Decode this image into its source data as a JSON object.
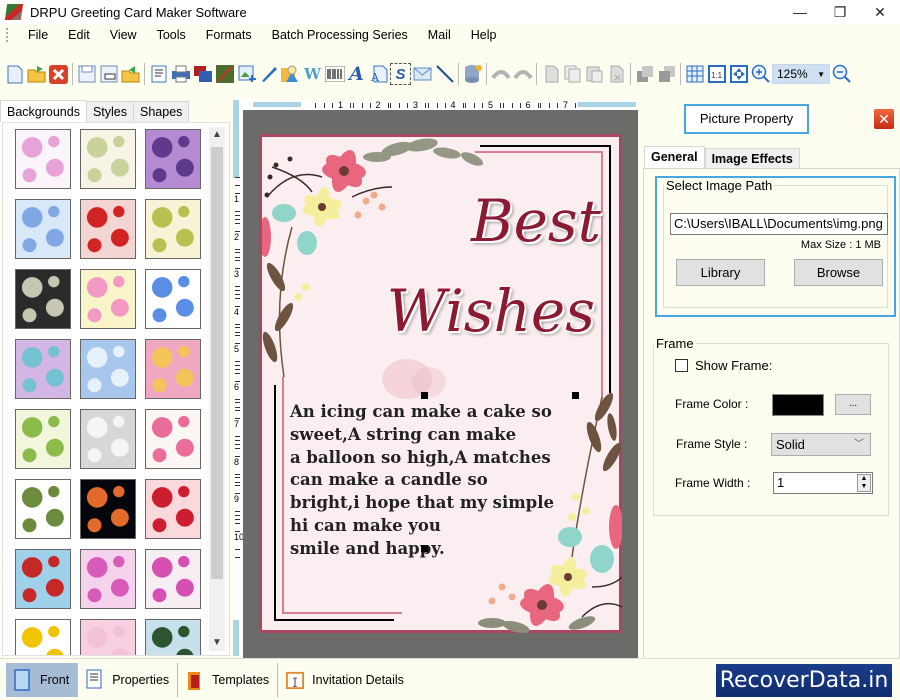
{
  "window": {
    "title": "DRPU Greeting Card Maker Software",
    "controls": {
      "minimize": "—",
      "restore": "❐",
      "close": "✕"
    }
  },
  "menu": [
    "File",
    "Edit",
    "View",
    "Tools",
    "Formats",
    "Batch Processing Series",
    "Mail",
    "Help"
  ],
  "toolbar": {
    "icons": [
      "new-icon",
      "open-icon",
      "close-icon",
      "save-icon",
      "save-as-icon",
      "export-icon",
      "properties-icon",
      "print-icon",
      "layers-icon",
      "image-icon",
      "insert-image-icon",
      "pen-icon",
      "shape-icon",
      "watermark-icon",
      "barcode-icon",
      "text-icon",
      "word-art-icon",
      "signature-icon",
      "mail-icon",
      "line-icon",
      "database-icon",
      "undo-icon",
      "redo-icon",
      "cut-icon",
      "copy-icon",
      "paste-icon",
      "delete-icon",
      "bring-front-icon",
      "send-back-icon",
      "grid-icon",
      "actual-size-icon",
      "fit-window-icon",
      "zoom-in-icon",
      "zoom-out-icon"
    ],
    "zoom_value": "125%"
  },
  "left_panel": {
    "tabs": [
      "Backgrounds",
      "Styles",
      "Shapes"
    ],
    "active_tab": "Backgrounds",
    "thumbnails": [
      {
        "name": "baby-pink",
        "colors": [
          "#fbf4fa",
          "#e7a3d8"
        ]
      },
      {
        "name": "baby-cream",
        "colors": [
          "#f7f4e6",
          "#c9d29a"
        ]
      },
      {
        "name": "purple-floral",
        "colors": [
          "#b48ad2",
          "#5f3a8c"
        ]
      },
      {
        "name": "clouds",
        "colors": [
          "#d9e8f9",
          "#7fa8e4"
        ]
      },
      {
        "name": "strawberries",
        "colors": [
          "#f3d6d3",
          "#d32424"
        ]
      },
      {
        "name": "leaves",
        "colors": [
          "#f8f3d6",
          "#b5c24f"
        ]
      },
      {
        "name": "dark-hexagons",
        "colors": [
          "#2b2b2b",
          "#c7c6b1"
        ]
      },
      {
        "name": "dotted-flowers",
        "colors": [
          "#f9f5c8",
          "#f29ac4"
        ]
      },
      {
        "name": "gifts",
        "colors": [
          "#ffffff",
          "#5a8ee6"
        ]
      },
      {
        "name": "colorful-circles",
        "colors": [
          "#d3b6e6",
          "#74c1d3"
        ]
      },
      {
        "name": "snowflakes",
        "colors": [
          "#a7c8ec",
          "#e6f1fb"
        ]
      },
      {
        "name": "mandala",
        "colors": [
          "#f0a7c2",
          "#f4c55a"
        ]
      },
      {
        "name": "xmas-trees",
        "colors": [
          "#f2f7dc",
          "#8dbb4b"
        ]
      },
      {
        "name": "heart-grey",
        "colors": [
          "#d7d7d7",
          "#f5f5f5"
        ]
      },
      {
        "name": "kids-party",
        "colors": [
          "#fcf7f2",
          "#e96c9a"
        ]
      },
      {
        "name": "hanging-bags",
        "colors": [
          "#ffffff",
          "#6c8b3c"
        ]
      },
      {
        "name": "fireworks",
        "colors": [
          "#05050c",
          "#e26b2b"
        ]
      },
      {
        "name": "hearts",
        "colors": [
          "#fbd8dc",
          "#cc1e2f"
        ]
      },
      {
        "name": "santa",
        "colors": [
          "#9fd2ea",
          "#c62828"
        ]
      },
      {
        "name": "pink-lace",
        "colors": [
          "#f5d3ec",
          "#d85bb9"
        ]
      },
      {
        "name": "butterflies",
        "colors": [
          "#f7eef3",
          "#d64fb2"
        ]
      },
      {
        "name": "stars",
        "colors": [
          "#ffffff",
          "#f2c400"
        ]
      },
      {
        "name": "pink-plain",
        "colors": [
          "#f7cfe0",
          "#f3c1d7"
        ]
      },
      {
        "name": "snowmen",
        "colors": [
          "#c7e0ec",
          "#2b5530"
        ]
      }
    ]
  },
  "rulers": {
    "horizontal": [
      "1",
      "2",
      "3",
      "4",
      "5",
      "6",
      "7"
    ],
    "vertical": [
      "1",
      "2",
      "3",
      "4",
      "5",
      "6",
      "7",
      "8",
      "9",
      "10"
    ]
  },
  "card": {
    "title_line1": "Best",
    "title_line2": "Wishes",
    "message_lines": [
      "An icing can make a cake so",
      "sweet,A string can make",
      "a balloon so high,A matches",
      "can make a candle so",
      "bright,i hope that my simple",
      "hi can make you",
      "smile and happy."
    ],
    "colors": {
      "title": "#8b1a33",
      "border": "#a84860",
      "background": "#fbeef1"
    }
  },
  "right_panel": {
    "title": "Picture Property",
    "tabs": [
      "General",
      "Image Effects"
    ],
    "active_tab": "General",
    "image_path": {
      "legend": "Select Image Path",
      "value": "C:\\Users\\IBALL\\Documents\\img.png",
      "max_size": "Max Size : 1 MB",
      "library_label": "Library",
      "browse_label": "Browse"
    },
    "frame": {
      "legend": "Frame",
      "show_frame_label": "Show Frame:",
      "show_frame_checked": false,
      "color_label": "Frame Color :",
      "color_value": "#000000",
      "color_picker_label": "...",
      "style_label": "Frame Style :",
      "style_value": "Solid",
      "width_label": "Frame Width :",
      "width_value": "1"
    }
  },
  "bottom_bar": {
    "items": [
      "Front",
      "Properties",
      "Templates",
      "Invitation Details"
    ],
    "active": "Front"
  },
  "brand": "RecoverData.in"
}
